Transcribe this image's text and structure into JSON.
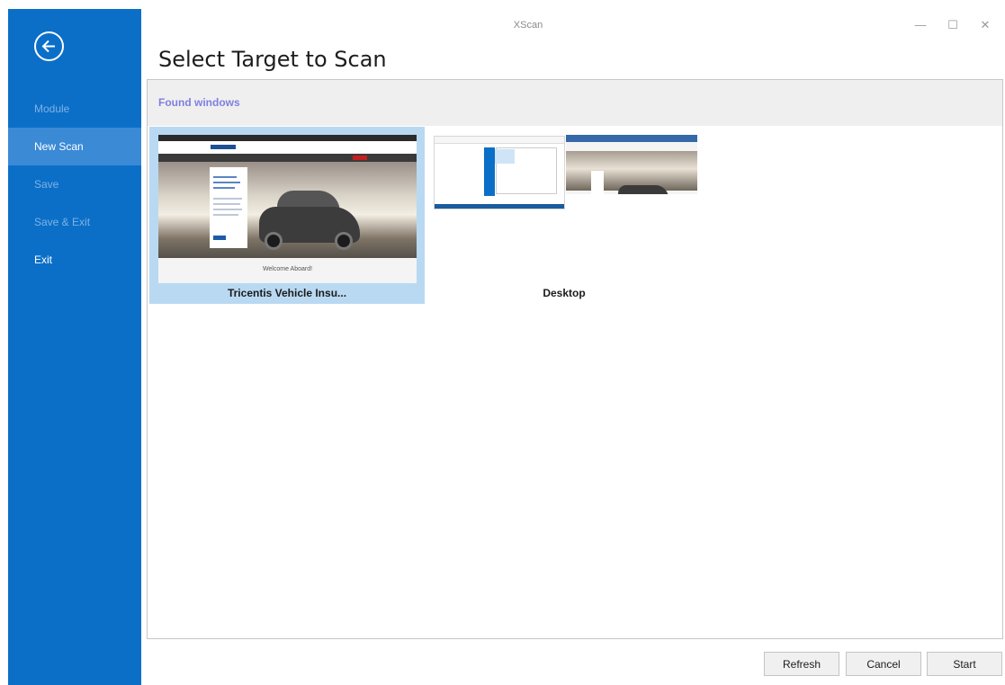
{
  "window": {
    "title": "XScan",
    "minimize_glyph": "—",
    "maximize_glyph": "☐",
    "close_glyph": "✕"
  },
  "sidebar": {
    "back_icon": "back-arrow-circle-icon",
    "items": [
      {
        "label": "Module",
        "state": "disabled"
      },
      {
        "label": "New Scan",
        "state": "active"
      },
      {
        "label": "Save",
        "state": "disabled"
      },
      {
        "label": "Save & Exit",
        "state": "disabled"
      },
      {
        "label": "Exit",
        "state": "enabled"
      }
    ]
  },
  "page": {
    "title": "Select Target to Scan"
  },
  "panel": {
    "header": "Found windows",
    "tiles": [
      {
        "caption": "Tricentis Vehicle Insu...",
        "selected": true,
        "thumb_text": "Welcome Aboard!"
      },
      {
        "caption": "Desktop",
        "selected": false
      }
    ]
  },
  "footer": {
    "refresh_label": "Refresh",
    "cancel_label": "Cancel",
    "start_label": "Start"
  },
  "colors": {
    "sidebar": "#0b6fc8",
    "sidebar_active": "#3b8ad5",
    "selected_tile": "#b9d9f2",
    "header_text": "#7f7fe0"
  }
}
